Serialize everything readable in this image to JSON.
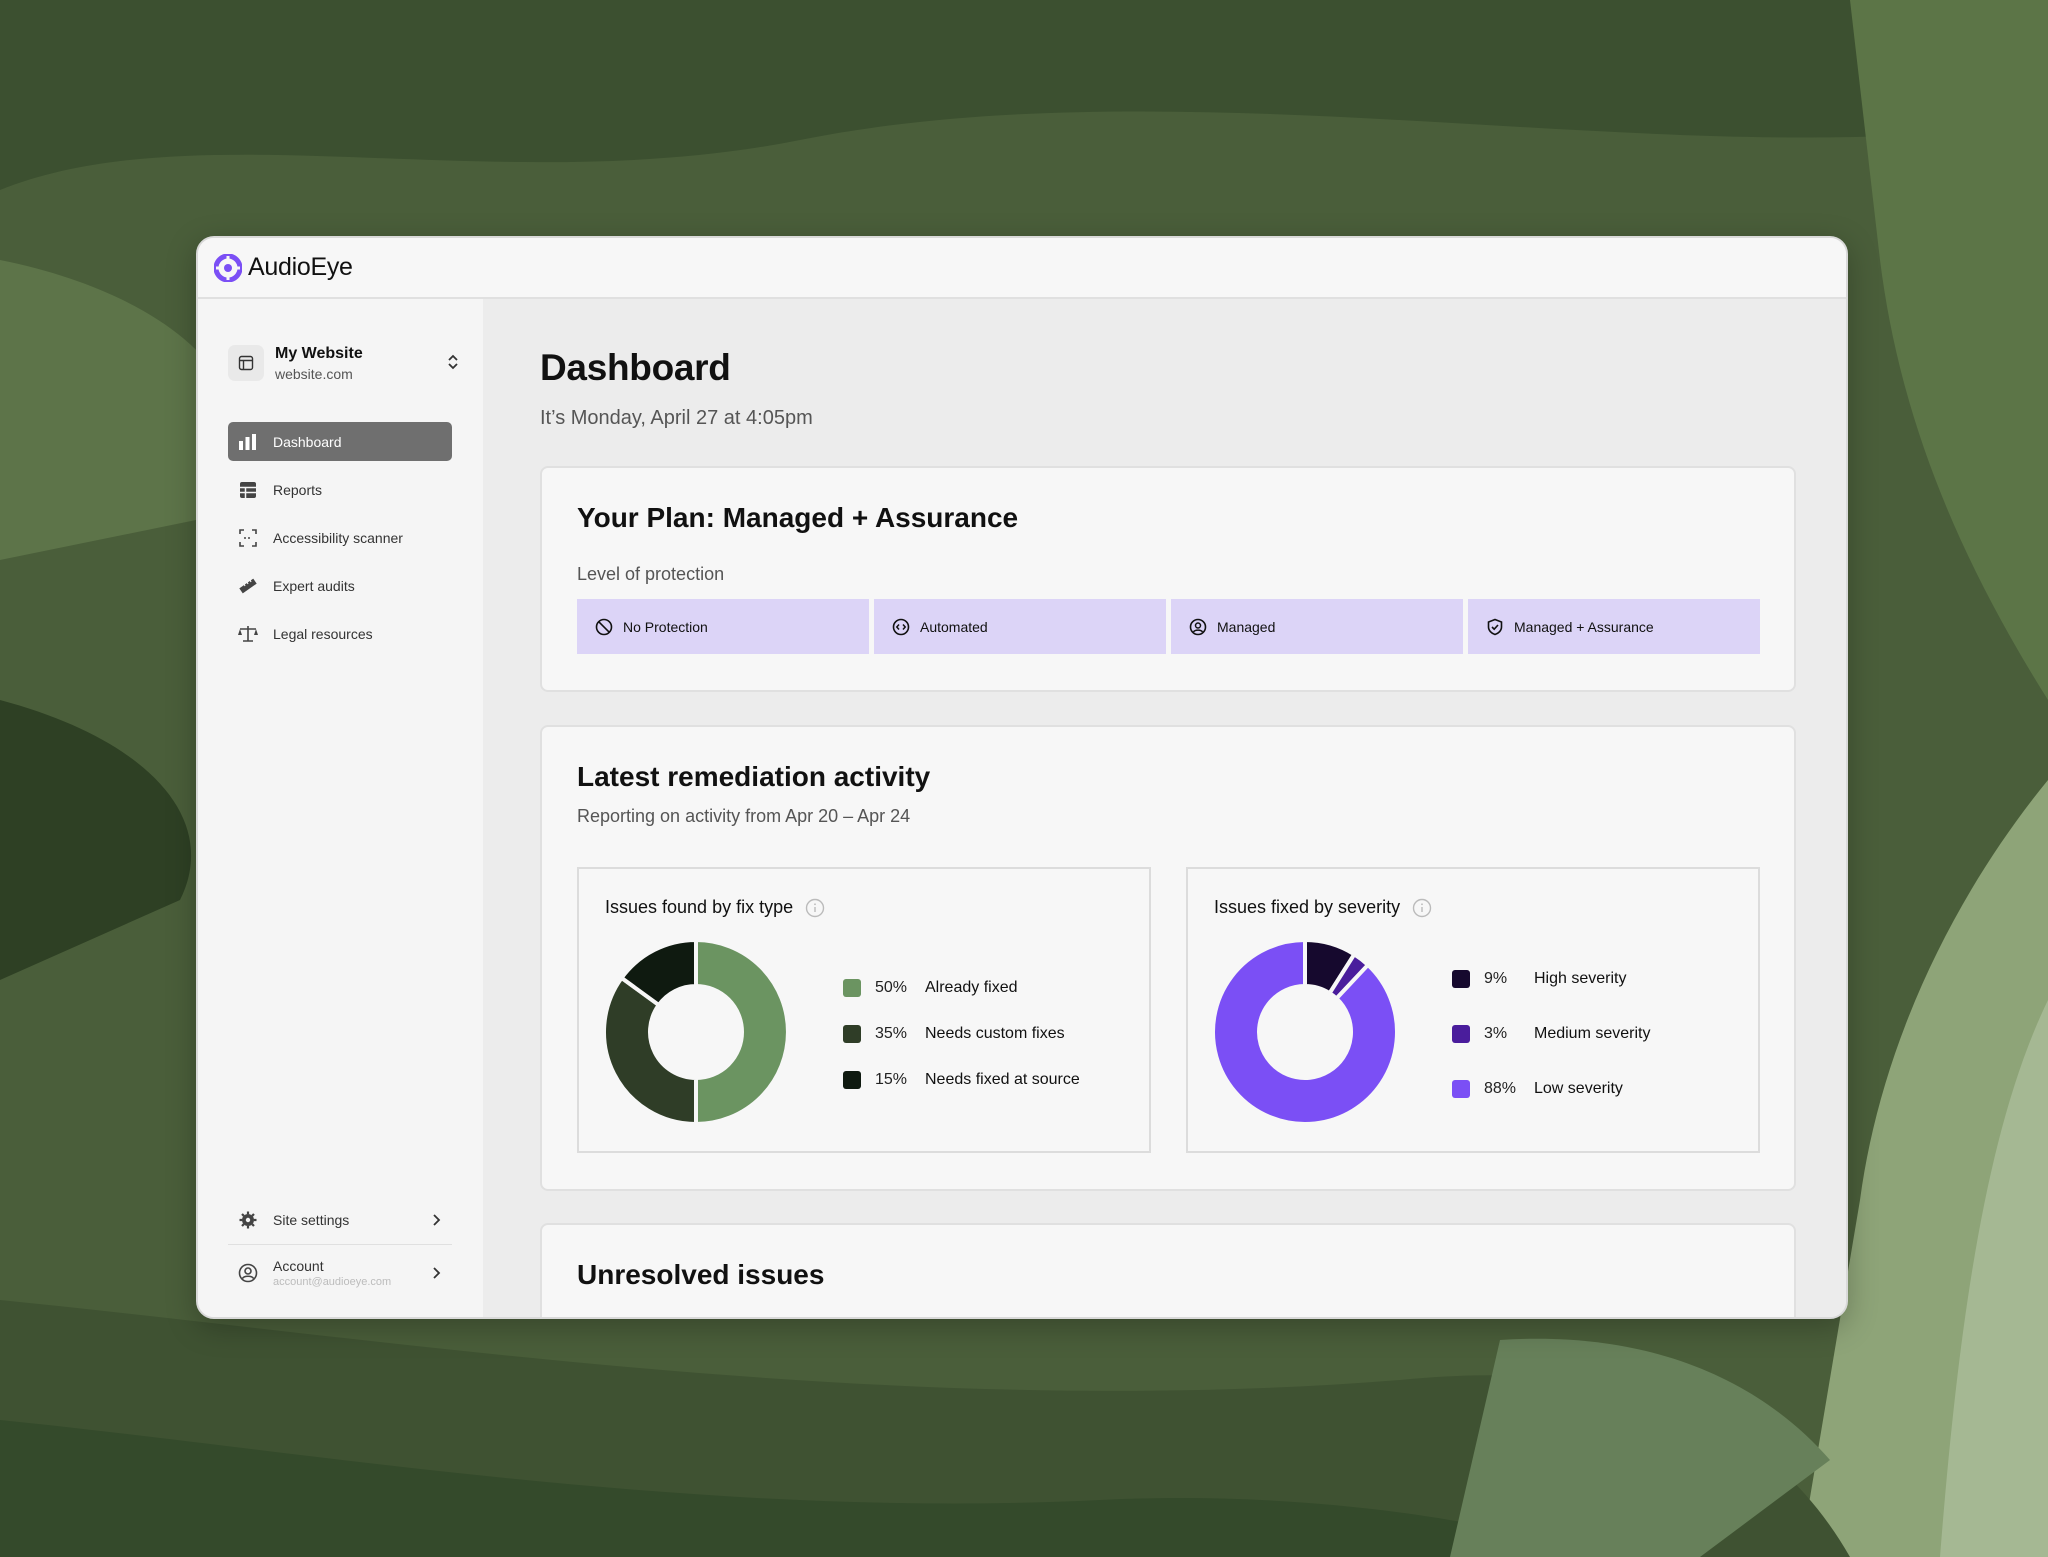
{
  "app": {
    "brand": "AudioEye"
  },
  "sidebar": {
    "site": {
      "name": "My Website",
      "url": "website.com"
    },
    "items": [
      {
        "label": "Dashboard",
        "icon": "bar-chart-icon",
        "active": true
      },
      {
        "label": "Reports",
        "icon": "table-icon"
      },
      {
        "label": "Accessibility scanner",
        "icon": "scan-icon"
      },
      {
        "label": "Expert audits",
        "icon": "ruler-icon"
      },
      {
        "label": "Legal resources",
        "icon": "scale-icon"
      }
    ],
    "settings_label": "Site settings",
    "account": {
      "label": "Account",
      "email": "account@audioeye.com"
    }
  },
  "main": {
    "title": "Dashboard",
    "date": "It’s Monday, April 27 at 4:05pm",
    "plan": {
      "title": "Your Plan: Managed + Assurance",
      "level_label": "Level of protection",
      "levels": [
        {
          "label": "No Protection",
          "icon": "block-icon"
        },
        {
          "label": "Automated",
          "icon": "code-icon"
        },
        {
          "label": "Managed",
          "icon": "user-circle-icon"
        },
        {
          "label": "Managed + Assurance",
          "icon": "shield-check-icon"
        }
      ]
    },
    "activity": {
      "title": "Latest remediation activity",
      "subtitle": "Reporting on activity from Apr 20 – Apr 24",
      "fix_type": {
        "title": "Issues found by fix type",
        "items": [
          {
            "pct": "50%",
            "label": "Already fixed",
            "value": 50,
            "color": "#6b9461"
          },
          {
            "pct": "35%",
            "label": "Needs custom fixes",
            "value": 35,
            "color": "#2f3d27"
          },
          {
            "pct": "15%",
            "label": "Needs fixed at source",
            "value": 15,
            "color": "#0f1a10"
          }
        ]
      },
      "severity": {
        "title": "Issues fixed by severity",
        "items": [
          {
            "pct": "9%",
            "label": "High severity",
            "value": 9,
            "color": "#16092e"
          },
          {
            "pct": "3%",
            "label": "Medium severity",
            "value": 3,
            "color": "#4a1d9c"
          },
          {
            "pct": "88%",
            "label": "Low severity",
            "value": 88,
            "color": "#7b4ff5"
          }
        ]
      }
    },
    "issues": {
      "title": "Unresolved issues"
    }
  },
  "colors": {
    "accent": "#7b4ff5",
    "level_bg": "#dcd4f7",
    "active_nav": "#6f6f6f"
  }
}
